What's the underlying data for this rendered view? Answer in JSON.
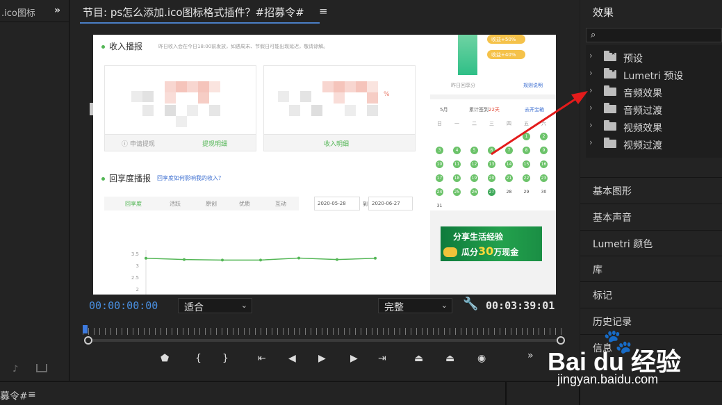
{
  "left_panel": {
    "tab_label": ".ico图标",
    "collapse_glyph": "»"
  },
  "monitor": {
    "title": "节目: ps怎么添加.ico图标格式插件？#招募令#",
    "menu_glyph": "≡",
    "timecode_current": "00:00:00:00",
    "timecode_duration": "00:03:39:01",
    "fit_select": "适合",
    "quality_select": "完整",
    "more_glyph": "»"
  },
  "video": {
    "income_title": "收入播报",
    "income_note": "昨日收入会在今日18:00前发放，如遇周末、节假日可能出现延迟，敬请谅解。",
    "card1_footer_left": "ⓘ 申请提现",
    "card1_footer_right": "提现明细",
    "card2_footer": "收入明细",
    "card2_partial": "%",
    "hui_title": "回享度播报",
    "hui_link": "回享度如何影响我的收入？",
    "legend": [
      "回享度",
      "活跃",
      "原创",
      "优质",
      "互动"
    ],
    "date_from": "2020-05-28",
    "date_to_prefix": "到",
    "date_to": "2020-06-27",
    "y_ticks": [
      "3.5",
      "3",
      "2.5",
      "2"
    ],
    "pill_1": "收益+50%",
    "pill_2": "收益+40%",
    "yesterday_label": "昨日回享分",
    "rule_link": "规则说明",
    "cal_month": "5月",
    "cal_days_label": "累计签到",
    "cal_days_value": "22天",
    "cal_link": "去开宝箱",
    "cal_weekdays": [
      "日",
      "一",
      "二",
      "三",
      "四",
      "五",
      "六"
    ],
    "cal_rows": [
      [
        "",
        "",
        "",
        "",
        "",
        "1",
        "2"
      ],
      [
        "3",
        "4",
        "5",
        "6",
        "7",
        "8",
        "9"
      ],
      [
        "10",
        "11",
        "12",
        "13",
        "14",
        "15",
        "16"
      ],
      [
        "17",
        "18",
        "19",
        "20",
        "21",
        "22",
        "23"
      ],
      [
        "24",
        "25",
        "26",
        "27",
        "28",
        "29",
        "30"
      ],
      [
        "31",
        "",
        "",
        "",
        "",
        "",
        ""
      ]
    ],
    "ad_line1": "分享生活经验",
    "ad_line2_pre": "瓜分",
    "ad_line2_num": "30",
    "ad_line2_post": "万现金"
  },
  "effects_panel": {
    "title": "效果",
    "search_glyph": "⌕",
    "tree": [
      {
        "label": "预设",
        "icon": "preset-folder-icon"
      },
      {
        "label": "Lumetri 预设",
        "icon": "preset-folder-icon"
      },
      {
        "label": "音频效果",
        "icon": "folder-icon"
      },
      {
        "label": "音频过渡",
        "icon": "folder-icon"
      },
      {
        "label": "视频效果",
        "icon": "folder-icon"
      },
      {
        "label": "视频过渡",
        "icon": "folder-icon"
      }
    ],
    "sections": [
      "基本图形",
      "基本声音",
      "Lumetri 颜色",
      "库",
      "标记",
      "历史记录",
      "信息"
    ]
  },
  "bottom": {
    "title": "募令#",
    "menu_glyph": "≡"
  },
  "watermark": {
    "brand": "Bai du 经验",
    "url": "jingyan.baidu.com",
    "paw_glyph": "🐾"
  },
  "colors": {
    "accent_blue": "#4a90e2",
    "annotation_red": "#e31b1b",
    "site_green": "#53b655"
  },
  "chart_data": {
    "type": "line",
    "x": [
      "1",
      "2",
      "3",
      "4",
      "5",
      "6",
      "7"
    ],
    "series": [
      {
        "name": "回享度",
        "values": [
          3.45,
          3.4,
          3.38,
          3.38,
          3.46,
          3.4,
          3.45
        ]
      }
    ],
    "ylim": [
      2,
      3.5
    ],
    "yticks": [
      "3.5",
      "3",
      "2.5",
      "2"
    ]
  }
}
